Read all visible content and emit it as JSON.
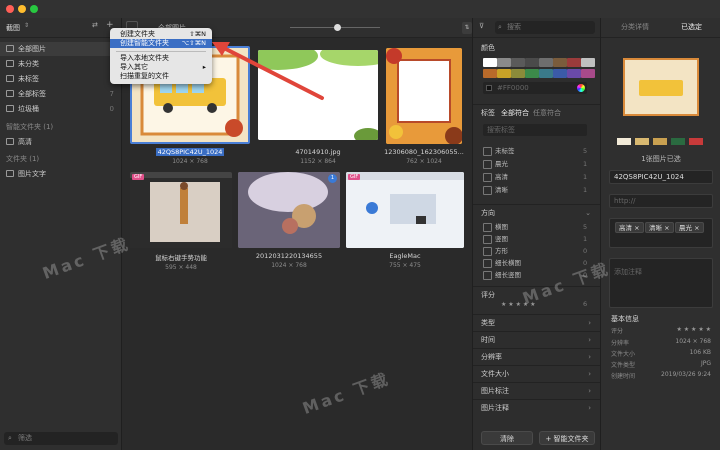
{
  "sidebar": {
    "header": "截图",
    "items": [
      {
        "label": "全部图片",
        "count": ""
      },
      {
        "label": "未分类",
        "count": ""
      },
      {
        "label": "未标签",
        "count": ""
      },
      {
        "label": "全部标签",
        "count": "7"
      },
      {
        "label": "垃圾桶",
        "count": "0"
      }
    ],
    "smart_section": "智能文件夹 (1)",
    "smart_items": [
      {
        "label": "高清"
      }
    ],
    "folder_section": "文件夹 (1)",
    "folder_items": [
      {
        "label": "图片文字"
      }
    ],
    "filter_placeholder": "筛选"
  },
  "toolbar": {
    "title": "全部图片",
    "search_placeholder": "搜索"
  },
  "menu": {
    "items": [
      {
        "label": "创建文件夹",
        "shortcut": "⇧⌘N"
      },
      {
        "label": "创建智能文件夹",
        "shortcut": "⌥⇧⌘N"
      },
      {
        "label": "导入本地文件夹",
        "shortcut": ""
      },
      {
        "label": "导入其它",
        "shortcut": ""
      },
      {
        "label": "扫描重复的文件",
        "shortcut": ""
      }
    ]
  },
  "images": [
    {
      "name": "42QS8PIC42U_1024",
      "dims": "1024 × 768",
      "selected": true
    },
    {
      "name": "47014910.jpg",
      "dims": "1152 × 864",
      "selected": false
    },
    {
      "name": "12306080_162306055...",
      "dims": "762 × 1024",
      "selected": false
    },
    {
      "name": "鼠标右键手势功能",
      "dims": "595 × 448",
      "selected": false,
      "badge": "GIF"
    },
    {
      "name": "2012031220134655",
      "dims": "1024 × 768",
      "selected": false,
      "badge": "1"
    },
    {
      "name": "EagleMac",
      "dims": "755 × 475",
      "selected": false,
      "badge": "GIF"
    }
  ],
  "filter": {
    "color_title": "颜色",
    "color_hex_placeholder": "#FF0000",
    "swatch_colors": [
      "#ffffff",
      "#8a8a8a",
      "#5a5a5a",
      "#4a4a4a",
      "#6e6e6e",
      "#7a5c3c",
      "#9b3b3b",
      "#c0c0c0",
      "#b86a2a",
      "#c9a227",
      "#8b8b3a",
      "#3c8a4a",
      "#3a7a8a",
      "#3b5ba8",
      "#6a4aa8",
      "#a84a8a"
    ],
    "tag_title": "标签",
    "tag_all": "全部符合",
    "tag_any": "任意符合",
    "tag_search_placeholder": "搜索标签",
    "tags": [
      {
        "label": "未标签",
        "count": "5"
      },
      {
        "label": "晨光",
        "count": "1"
      },
      {
        "label": "高清",
        "count": "1"
      },
      {
        "label": "清晰",
        "count": "1"
      }
    ],
    "orient_title": "方向",
    "orients": [
      {
        "label": "横图",
        "count": "5"
      },
      {
        "label": "竖图",
        "count": "1"
      },
      {
        "label": "方形",
        "count": "0"
      },
      {
        "label": "细长横图",
        "count": "0"
      },
      {
        "label": "细长竖图",
        "count": "0"
      }
    ],
    "rating_title": "评分",
    "rating_count": "6",
    "sections": [
      "类型",
      "时间",
      "分辨率",
      "文件大小",
      "图片标注",
      "图片注释"
    ],
    "clear_label": "清除",
    "smart_label": "+ 智能文件夹"
  },
  "detail": {
    "tab_info": "分类详情",
    "tab_selected": "已选定",
    "palette": [
      "#f2ead8",
      "#d8b870",
      "#c9a050",
      "#2a6a40",
      "#c83a3a"
    ],
    "count_text": "1张图片已选",
    "name_value": "42QS8PIC42U_1024",
    "url_placeholder": "http://",
    "tags": [
      "高清",
      "清晰",
      "晨光"
    ],
    "note_placeholder": "添加注释",
    "info_title": "基本信息",
    "info": [
      {
        "k": "评分",
        "v": "★ ★ ★ ★ ★"
      },
      {
        "k": "分辨率",
        "v": "1024 × 768"
      },
      {
        "k": "文件大小",
        "v": "106 KB"
      },
      {
        "k": "文件类型",
        "v": "JPG"
      },
      {
        "k": "创建时间",
        "v": "2019/03/26 9:24"
      }
    ]
  },
  "watermark": "Mac 下载"
}
